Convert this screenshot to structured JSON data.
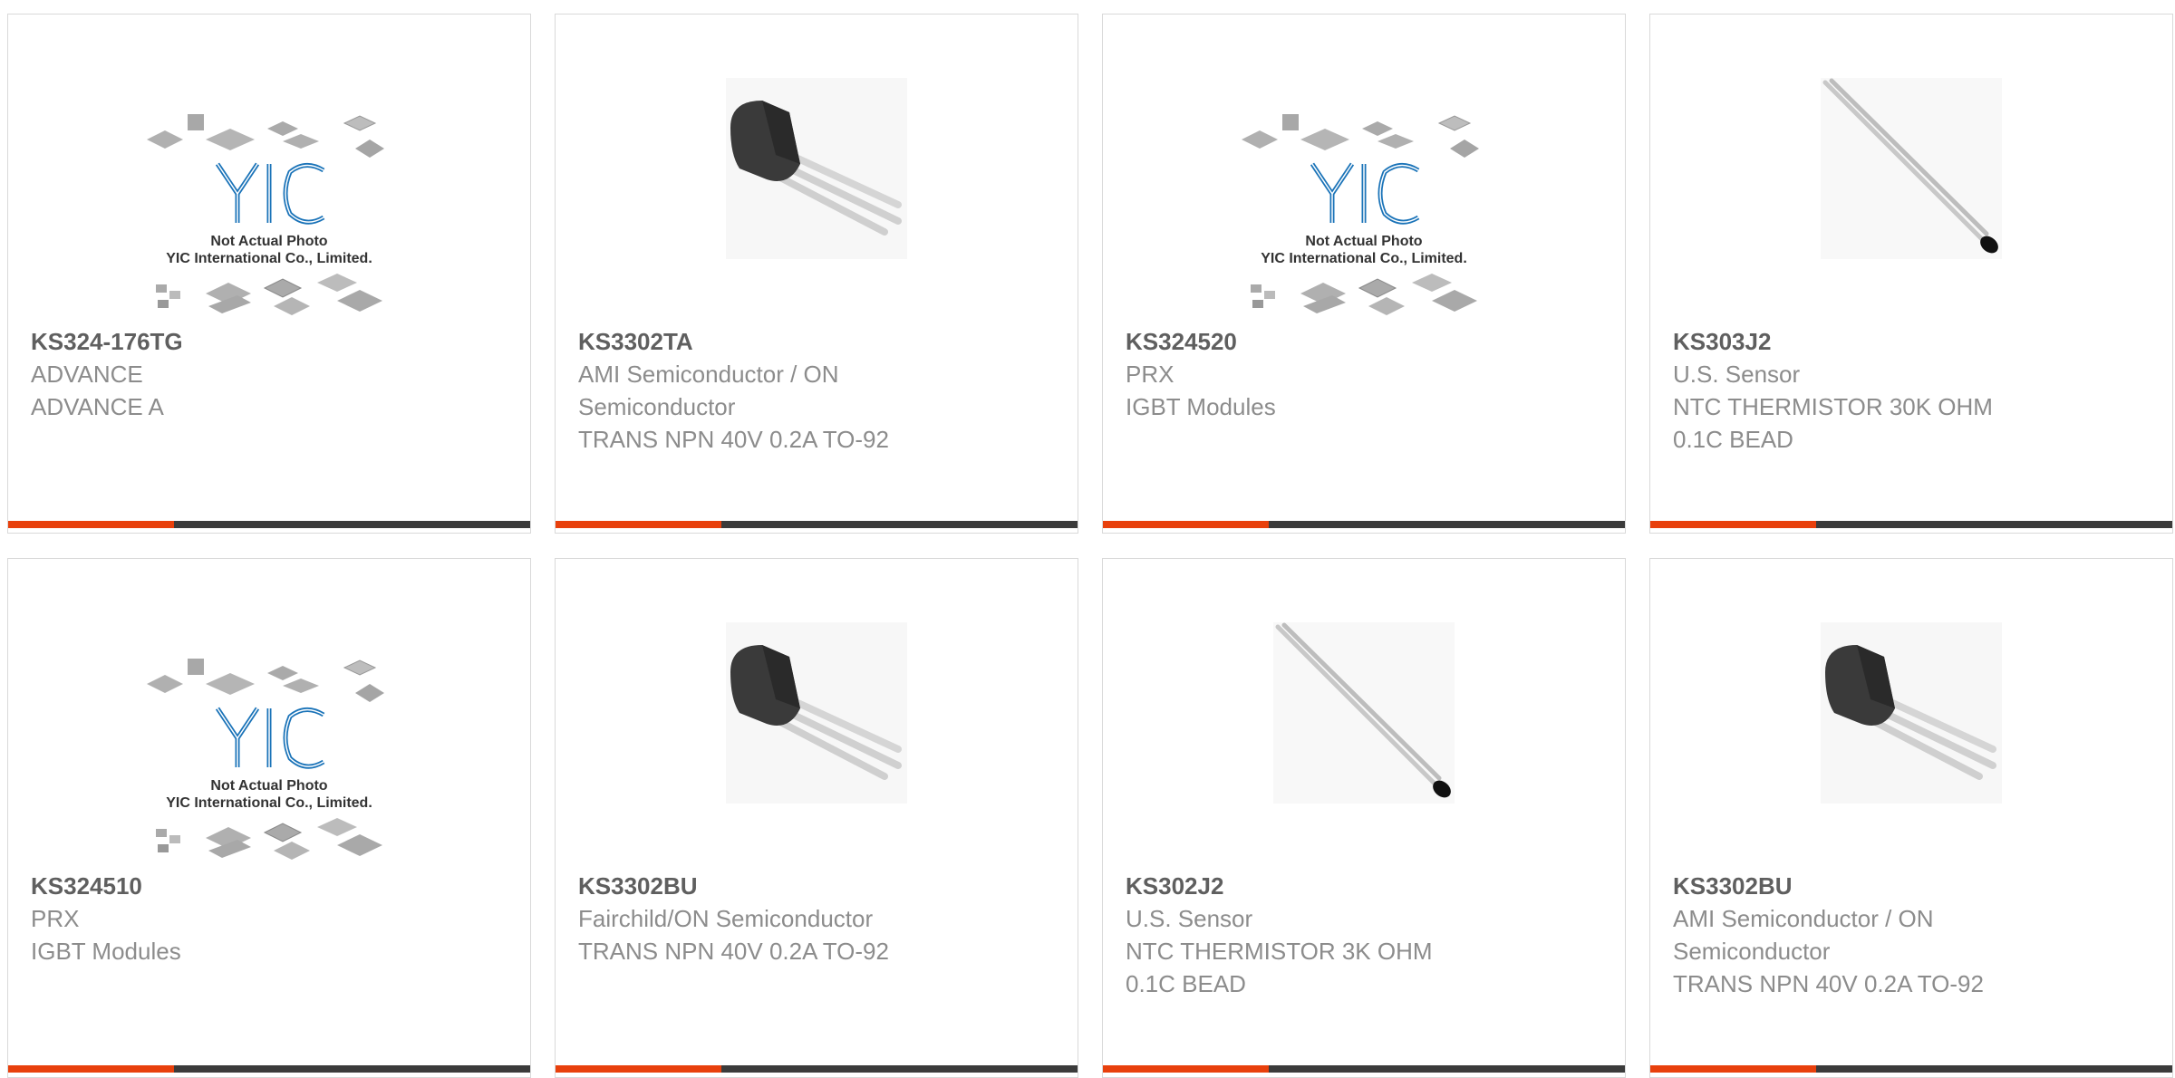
{
  "colors": {
    "accent_bar": "#e8400c",
    "dark_bar": "#3b3b3b",
    "part_number": "#5f5f5f",
    "text": "#8c8c8c",
    "logo_blue": "#1a73b8"
  },
  "products": [
    {
      "part_number": "KS324-176TG",
      "lines": [
        "ADVANCE",
        "ADVANCE A"
      ],
      "image": "yic-placeholder",
      "image_caption": [
        "Not Actual Photo",
        "YIC International Co., Limited."
      ]
    },
    {
      "part_number": "KS3302TA",
      "lines": [
        "AMI Semiconductor / ON",
        "Semiconductor",
        "TRANS NPN 40V 0.2A TO-92"
      ],
      "image": "to92-transistor"
    },
    {
      "part_number": "KS324520",
      "lines": [
        "PRX",
        "IGBT Modules"
      ],
      "image": "yic-placeholder",
      "image_caption": [
        "Not Actual Photo",
        "YIC International Co., Limited."
      ]
    },
    {
      "part_number": "KS303J2",
      "lines": [
        "U.S. Sensor",
        "NTC THERMISTOR 30K OHM",
        "0.1C BEAD"
      ],
      "image": "thermistor"
    },
    {
      "part_number": "KS324510",
      "lines": [
        "PRX",
        "IGBT Modules"
      ],
      "image": "yic-placeholder",
      "image_caption": [
        "Not Actual Photo",
        "YIC International Co., Limited."
      ]
    },
    {
      "part_number": "KS3302BU",
      "lines": [
        "Fairchild/ON Semiconductor",
        "TRANS NPN 40V 0.2A TO-92"
      ],
      "image": "to92-transistor"
    },
    {
      "part_number": "KS302J2",
      "lines": [
        "U.S. Sensor",
        "NTC THERMISTOR 3K OHM",
        "0.1C BEAD"
      ],
      "image": "thermistor"
    },
    {
      "part_number": "KS3302BU",
      "lines": [
        "AMI Semiconductor / ON",
        "Semiconductor",
        "TRANS NPN 40V 0.2A TO-92"
      ],
      "image": "to92-transistor"
    }
  ]
}
